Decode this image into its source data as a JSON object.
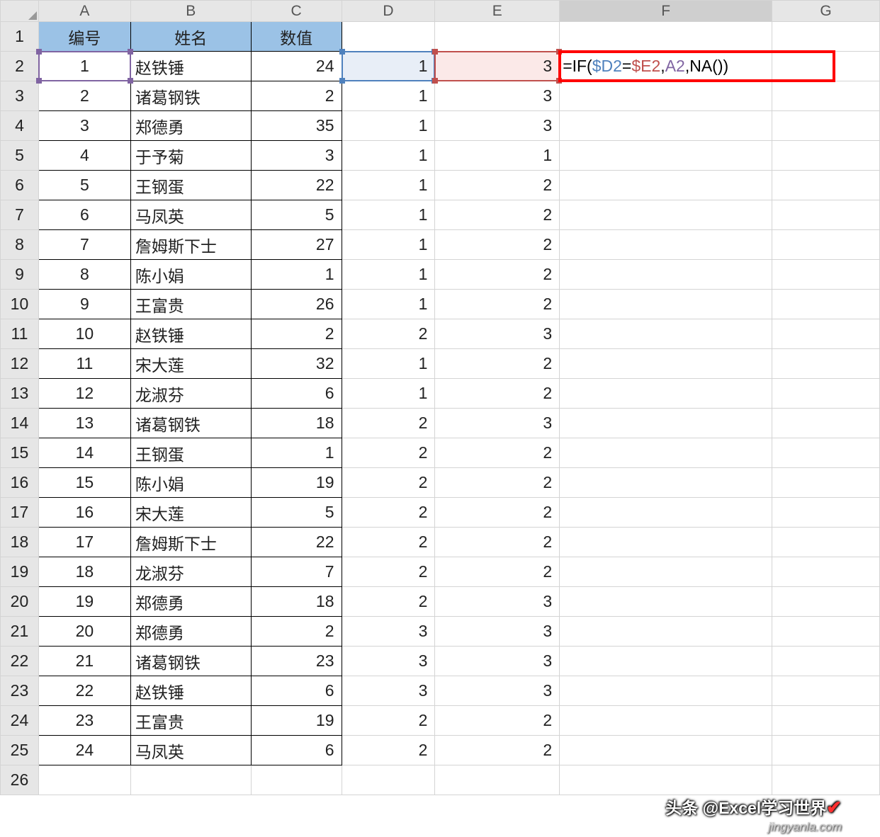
{
  "columns": [
    "A",
    "B",
    "C",
    "D",
    "E",
    "F",
    "G"
  ],
  "row_numbers": [
    1,
    2,
    3,
    4,
    5,
    6,
    7,
    8,
    9,
    10,
    11,
    12,
    13,
    14,
    15,
    16,
    17,
    18,
    19,
    20,
    21,
    22,
    23,
    24,
    25,
    26
  ],
  "headers": {
    "A": "编号",
    "B": "姓名",
    "C": "数值"
  },
  "formula": {
    "prefix": "=IF(",
    "ref1": "$D2",
    "eq": "=",
    "ref2": "$E2",
    "comma1": ",",
    "ref3": "A2",
    "comma2": ",",
    "na": "NA()",
    "suffix": ")"
  },
  "rows": [
    {
      "A": "1",
      "B": "赵铁锤",
      "C": "24",
      "D": "1",
      "E": "3"
    },
    {
      "A": "2",
      "B": "诸葛钢铁",
      "C": "2",
      "D": "1",
      "E": "3"
    },
    {
      "A": "3",
      "B": "郑德勇",
      "C": "35",
      "D": "1",
      "E": "3"
    },
    {
      "A": "4",
      "B": "于予菊",
      "C": "3",
      "D": "1",
      "E": "1"
    },
    {
      "A": "5",
      "B": "王钢蛋",
      "C": "22",
      "D": "1",
      "E": "2"
    },
    {
      "A": "6",
      "B": "马凤英",
      "C": "5",
      "D": "1",
      "E": "2"
    },
    {
      "A": "7",
      "B": "詹姆斯下士",
      "C": "27",
      "D": "1",
      "E": "2"
    },
    {
      "A": "8",
      "B": "陈小娟",
      "C": "1",
      "D": "1",
      "E": "2"
    },
    {
      "A": "9",
      "B": "王富贵",
      "C": "26",
      "D": "1",
      "E": "2"
    },
    {
      "A": "10",
      "B": "赵铁锤",
      "C": "2",
      "D": "2",
      "E": "3"
    },
    {
      "A": "11",
      "B": "宋大莲",
      "C": "32",
      "D": "1",
      "E": "2"
    },
    {
      "A": "12",
      "B": "龙淑芬",
      "C": "6",
      "D": "1",
      "E": "2"
    },
    {
      "A": "13",
      "B": "诸葛钢铁",
      "C": "18",
      "D": "2",
      "E": "3"
    },
    {
      "A": "14",
      "B": "王钢蛋",
      "C": "1",
      "D": "2",
      "E": "2"
    },
    {
      "A": "15",
      "B": "陈小娟",
      "C": "19",
      "D": "2",
      "E": "2"
    },
    {
      "A": "16",
      "B": "宋大莲",
      "C": "5",
      "D": "2",
      "E": "2"
    },
    {
      "A": "17",
      "B": "詹姆斯下士",
      "C": "22",
      "D": "2",
      "E": "2"
    },
    {
      "A": "18",
      "B": "龙淑芬",
      "C": "7",
      "D": "2",
      "E": "2"
    },
    {
      "A": "19",
      "B": "郑德勇",
      "C": "18",
      "D": "2",
      "E": "3"
    },
    {
      "A": "20",
      "B": "郑德勇",
      "C": "2",
      "D": "3",
      "E": "3"
    },
    {
      "A": "21",
      "B": "诸葛钢铁",
      "C": "23",
      "D": "3",
      "E": "3"
    },
    {
      "A": "22",
      "B": "赵铁锤",
      "C": "6",
      "D": "3",
      "E": "3"
    },
    {
      "A": "23",
      "B": "王富贵",
      "C": "19",
      "D": "2",
      "E": "2"
    },
    {
      "A": "24",
      "B": "马凤英",
      "C": "6",
      "D": "2",
      "E": "2"
    }
  ],
  "watermark_main": "头条 @Excel学习世界",
  "watermark_sub": "jingyanla.com"
}
